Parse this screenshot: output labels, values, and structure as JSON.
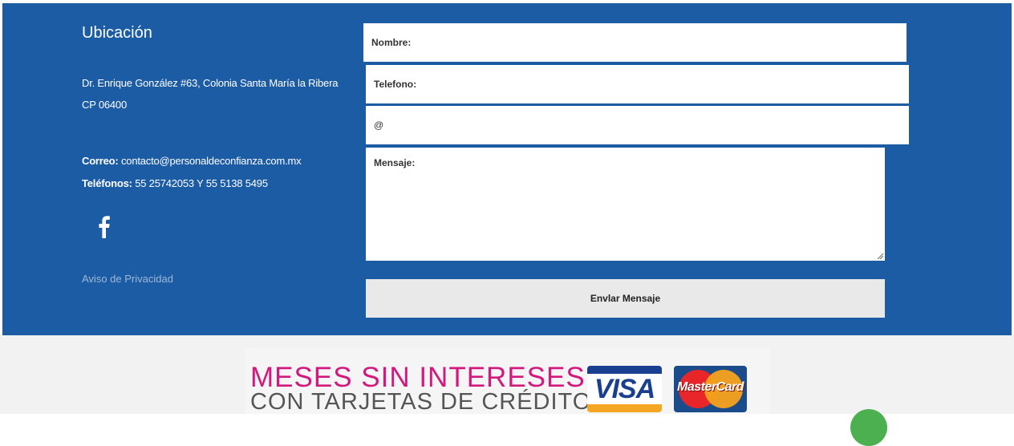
{
  "contact": {
    "title": "Ubicación",
    "address_line1": "Dr. Enrique González #63, Colonia Santa María la Ribera",
    "address_line2": "CP 06400",
    "email_label": "Correo:",
    "email": "contacto@personaldeconfianza.com.mx",
    "phone_label": "Teléfonos:",
    "phones": "55 25742053 Y 55 5138 5495",
    "social_icon": "facebook-icon",
    "privacy_link": "Aviso de Privacidad"
  },
  "form": {
    "name_label": "Nombre:",
    "phone_label": "Telefono:",
    "email_label": "@",
    "message_label": "Mensaje:",
    "submit_label": "Envlar Mensaje"
  },
  "promo": {
    "line1": "MESES SIN INTERESES",
    "line2": "CON TARJETAS DE CRÉDITO",
    "visa_logo": "VISA",
    "mastercard_logo": "MasterCard"
  },
  "colors": {
    "footer_blue": "#1b5ca4",
    "promo_pink": "#d2197d",
    "button_gray": "#e9e9e9"
  }
}
